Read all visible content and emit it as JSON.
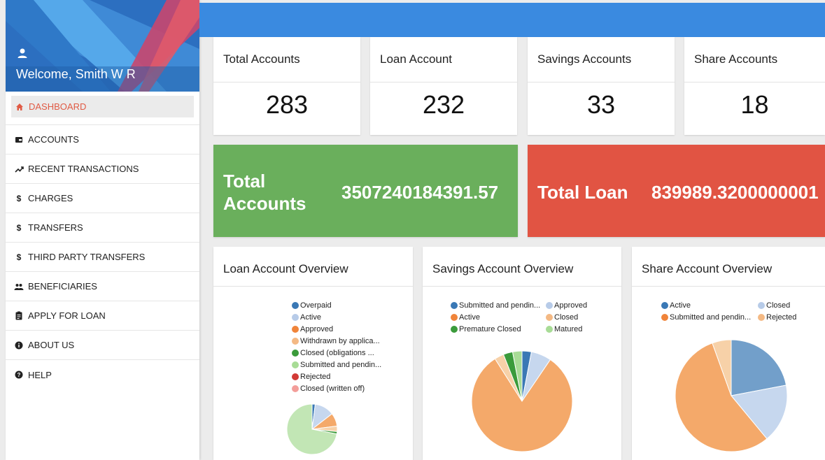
{
  "sidebar": {
    "welcome": "Welcome, Smith W R",
    "items": [
      {
        "label": "DASHBOARD",
        "icon": "home-icon"
      },
      {
        "label": "ACCOUNTS",
        "icon": "wallet-icon"
      },
      {
        "label": "RECENT TRANSACTIONS",
        "icon": "trending-up-icon"
      },
      {
        "label": "CHARGES",
        "icon": "dollar-icon"
      },
      {
        "label": "TRANSFERS",
        "icon": "dollar-icon"
      },
      {
        "label": "THIRD PARTY TRANSFERS",
        "icon": "dollar-icon"
      },
      {
        "label": "BENEFICIARIES",
        "icon": "people-icon"
      },
      {
        "label": "APPLY FOR LOAN",
        "icon": "clipboard-icon"
      },
      {
        "label": "ABOUT US",
        "icon": "info-icon"
      },
      {
        "label": "HELP",
        "icon": "help-icon"
      }
    ]
  },
  "colors": {
    "topbar": "#3a8ae0",
    "active": "#e05a44",
    "green": "#6aaf5c",
    "red": "#e15443"
  },
  "stats": [
    {
      "title": "Total Accounts",
      "value": "283"
    },
    {
      "title": "Loan Account",
      "value": "232"
    },
    {
      "title": "Savings Accounts",
      "value": "33"
    },
    {
      "title": "Share Accounts",
      "value": "18"
    }
  ],
  "totals": {
    "accounts_label_1": "Total",
    "accounts_label_2": "Accounts",
    "accounts_value": "3507240184391.57",
    "loan_label": "Total Loan",
    "loan_value": "839989.3200000001"
  },
  "overviews": {
    "loan": {
      "title": "Loan Account Overview",
      "legend": [
        {
          "label": "Overpaid",
          "color": "#3a78b5"
        },
        {
          "label": "Active",
          "color": "#b7cbe8"
        },
        {
          "label": "Approved",
          "color": "#f0843a"
        },
        {
          "label": "Withdrawn by applica...",
          "color": "#f4b984"
        },
        {
          "label": "Closed (obligations ...",
          "color": "#3b9b3b"
        },
        {
          "label": "Submitted and pendin...",
          "color": "#a8dc96"
        },
        {
          "label": "Rejected",
          "color": "#d23a36"
        },
        {
          "label": "Closed (written off)",
          "color": "#f39e9a"
        }
      ],
      "slices": [
        {
          "value": 2.0,
          "color": "#3a78b5"
        },
        {
          "value": 12.5,
          "color": "#c6d7ee"
        },
        {
          "value": 8.5,
          "color": "#f4a96a"
        },
        {
          "value": 3.5,
          "color": "#f7d1a8"
        },
        {
          "value": 1.5,
          "color": "#3b9b3b"
        },
        {
          "value": 72.0,
          "color": "#c2e6b5"
        }
      ]
    },
    "savings": {
      "title": "Savings Account Overview",
      "legend": [
        {
          "label": "Submitted and pendin...",
          "color": "#3a78b5"
        },
        {
          "label": "Approved",
          "color": "#b7cbe8"
        },
        {
          "label": "Active",
          "color": "#f0843a"
        },
        {
          "label": "Closed",
          "color": "#f4b984"
        },
        {
          "label": "Premature Closed",
          "color": "#3b9b3b"
        },
        {
          "label": "Matured",
          "color": "#a8dc96"
        }
      ],
      "slices": [
        {
          "value": 3.0,
          "color": "#3a78b5"
        },
        {
          "value": 6.5,
          "color": "#c6d7ee"
        },
        {
          "value": 81.5,
          "color": "#f4a96a"
        },
        {
          "value": 3.0,
          "color": "#f7d1a8"
        },
        {
          "value": 3.0,
          "color": "#3b9b3b"
        },
        {
          "value": 3.0,
          "color": "#a8dc96"
        }
      ]
    },
    "share": {
      "title": "Share Account Overview",
      "legend": [
        {
          "label": "Active",
          "color": "#3a78b5"
        },
        {
          "label": "Closed",
          "color": "#b7cbe8"
        },
        {
          "label": "Submitted and pendin...",
          "color": "#f0843a"
        },
        {
          "label": "Rejected",
          "color": "#f4b984"
        }
      ],
      "slices": [
        {
          "value": 22.0,
          "color": "#729fca"
        },
        {
          "value": 17.0,
          "color": "#c6d7ee"
        },
        {
          "value": 55.5,
          "color": "#f4a96a"
        },
        {
          "value": 5.5,
          "color": "#f7d1a8"
        }
      ]
    }
  }
}
